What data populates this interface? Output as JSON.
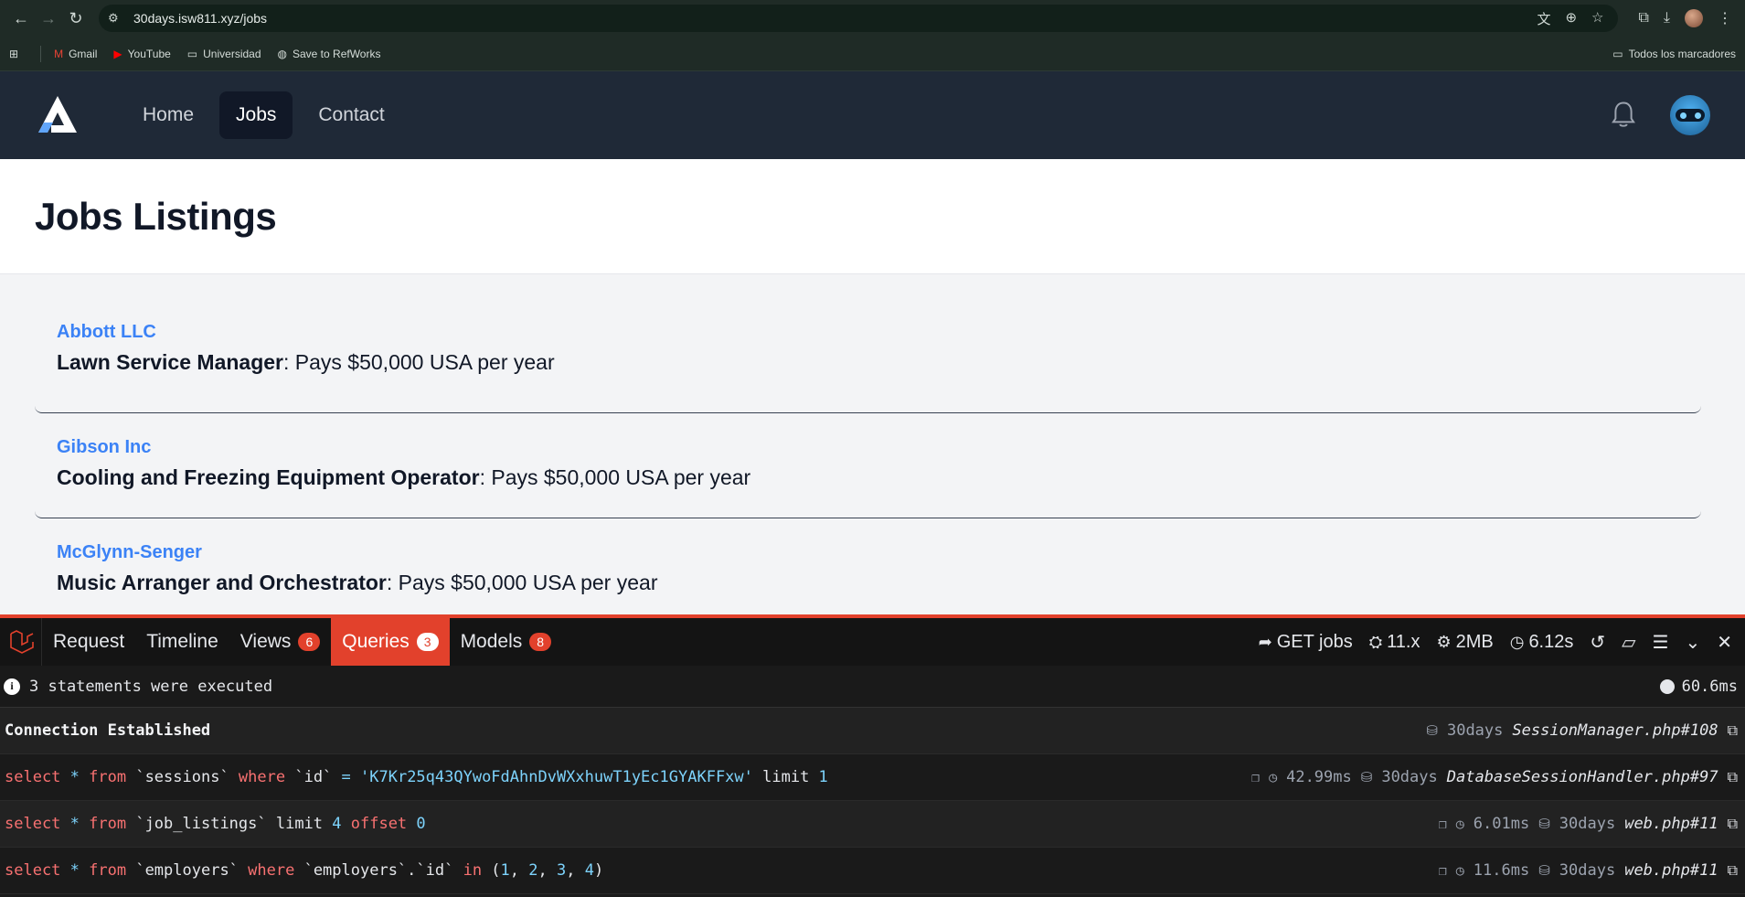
{
  "browser": {
    "url": "30days.isw811.xyz/jobs",
    "bookmarks": [
      "Gmail",
      "YouTube",
      "Universidad",
      "Save to RefWorks"
    ],
    "all_bookmarks": "Todos los marcadores"
  },
  "nav": {
    "links": [
      "Home",
      "Jobs",
      "Contact"
    ],
    "active": "Jobs"
  },
  "page": {
    "title": "Jobs Listings"
  },
  "jobs": [
    {
      "employer": "Abbott LLC",
      "title": "Lawn Service Manager",
      "salary": ": Pays $50,000 USA per year"
    },
    {
      "employer": "Gibson Inc",
      "title": "Cooling and Freezing Equipment Operator",
      "salary": ": Pays $50,000 USA per year"
    },
    {
      "employer": "McGlynn-Senger",
      "title": "Music Arranger and Orchestrator",
      "salary": ": Pays $50,000 USA per year"
    }
  ],
  "debugbar": {
    "tabs": [
      {
        "label": "Request",
        "badge": ""
      },
      {
        "label": "Timeline",
        "badge": ""
      },
      {
        "label": "Views",
        "badge": "6"
      },
      {
        "label": "Queries",
        "badge": "3"
      },
      {
        "label": "Models",
        "badge": "8"
      }
    ],
    "route": "GET jobs",
    "version": "11.x",
    "memory": "2MB",
    "duration": "6.12s",
    "summary": "3 statements were executed",
    "total_time": "60.6ms",
    "connection": {
      "label": "Connection Established",
      "db": "30days",
      "file": "SessionManager.php#108"
    },
    "queries": [
      {
        "time": "42.99ms",
        "db": "30days",
        "file": "DatabaseSessionHandler.php#97"
      },
      {
        "time": "6.01ms",
        "db": "30days",
        "file": "web.php#11"
      },
      {
        "time": "11.6ms",
        "db": "30days",
        "file": "web.php#11"
      }
    ],
    "q1": {
      "a": "select",
      "b": " * ",
      "c": "from",
      "d": " `sessions` ",
      "e": "where",
      "f": " `id` ",
      "g": "=",
      "h": " 'K7Kr25q43QYwoFdAhnDvWXxhuwT1yEc1GYAKFFxw'",
      "i": " limit ",
      "j": "1"
    },
    "q2": {
      "a": "select",
      "b": " * ",
      "c": "from",
      "d": " `job_listings` limit ",
      "e": "4",
      "f": " offset ",
      "g": "0"
    },
    "q3": {
      "a": "select",
      "b": " * ",
      "c": "from",
      "d": " `employers` ",
      "e": "where",
      "f": " `employers`.`id` ",
      "g": "in",
      "h": " (",
      "i": "1",
      "j": ", ",
      "k": "2",
      "l": ", ",
      "m": "3",
      "n": ", ",
      "o": "4",
      "p": ")"
    }
  }
}
